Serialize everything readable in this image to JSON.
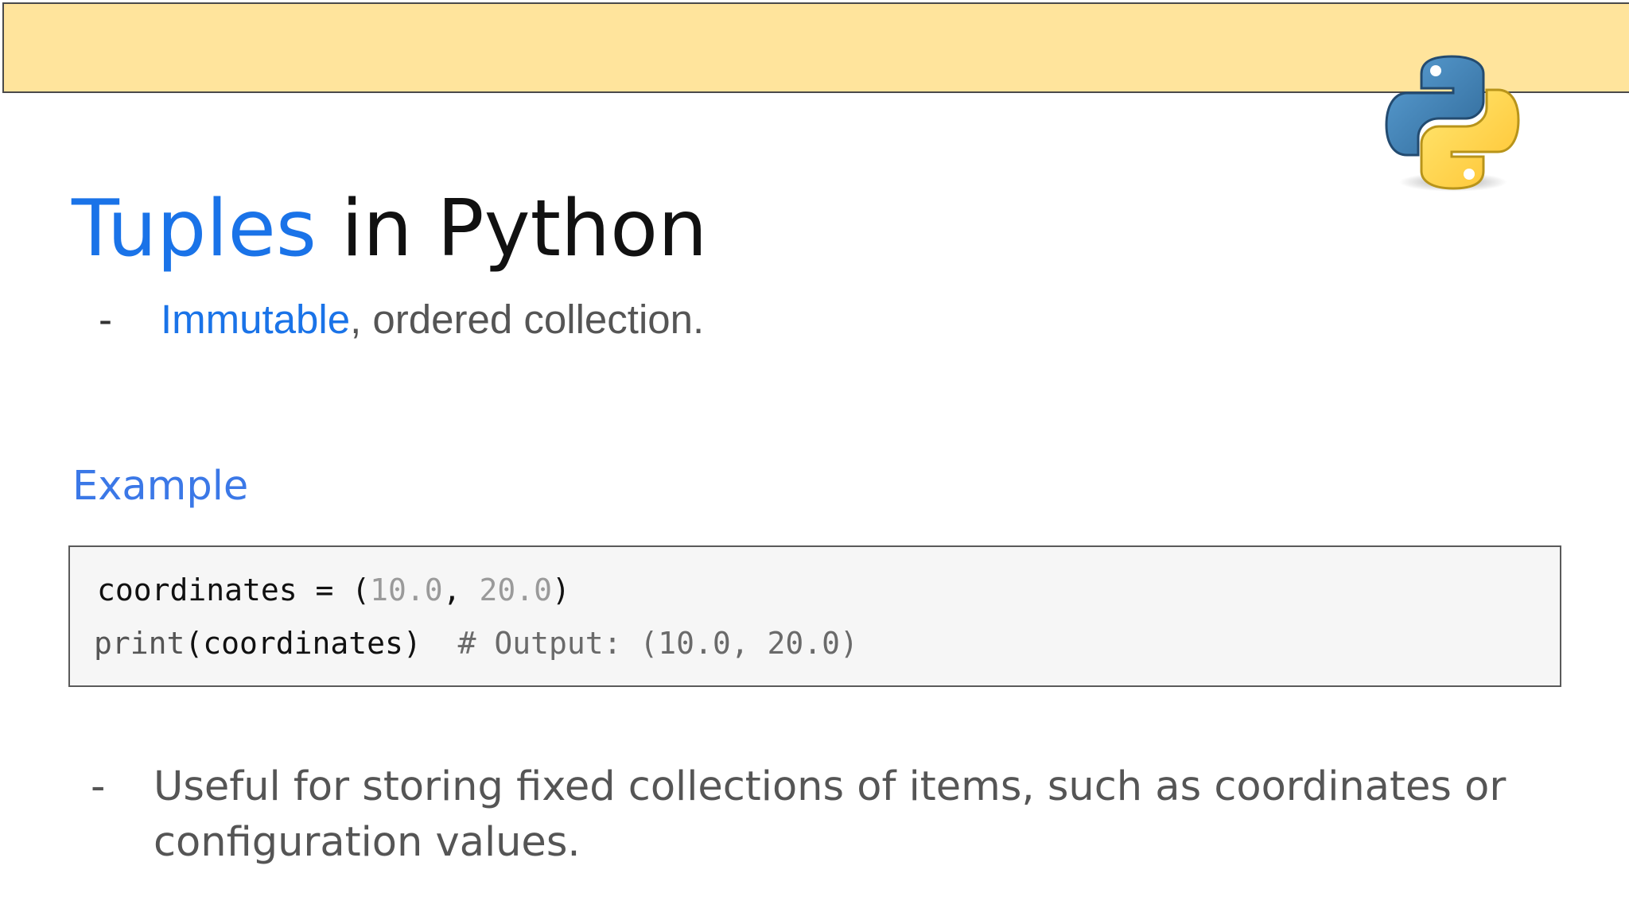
{
  "slide": {
    "title": {
      "accent": "Tuples",
      "rest": " in Python"
    },
    "bullet1": {
      "marker": "-",
      "accent": "Immutable",
      "rest": ", ordered collection."
    },
    "example_heading": "Example",
    "code": {
      "line1": {
        "name": "coordinates = (",
        "n1": "10.0",
        "sep": ", ",
        "n2": "20.0",
        "close": ")"
      },
      "line2": {
        "fn": "print",
        "args": "(coordinates)",
        "comment": "  # Output: ",
        "output": "(10.0, 20.0)"
      }
    },
    "bullet2": {
      "marker": "-",
      "text": "Useful for storing fixed collections of items, such as coordinates or configuration values."
    },
    "logo": "python-logo-icon"
  },
  "colors": {
    "header_band": "#ffe49c",
    "accent_blue": "#1a73e8",
    "example_blue": "#3b78e7",
    "code_bg": "#f6f6f6",
    "python_blue": "#3a6d9c",
    "python_yellow": "#ffd43b"
  }
}
